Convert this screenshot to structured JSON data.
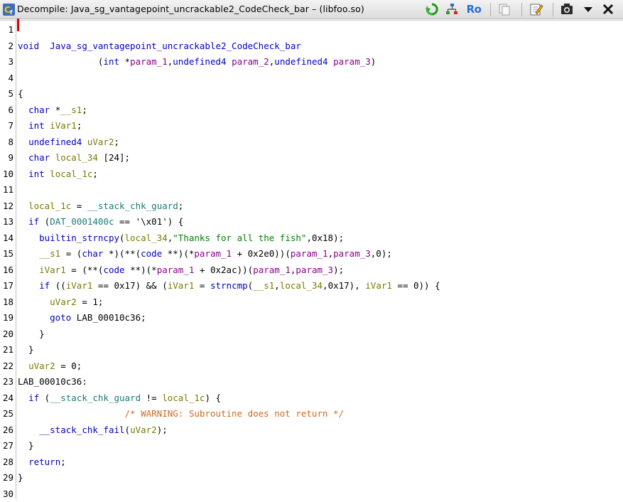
{
  "window": {
    "title": "Decompile: Java_sg_vantagepoint_uncrackable2_CodeCheck_bar – (libfoo.so)"
  },
  "toolbar": {
    "buttons": [
      {
        "name": "refresh-icon"
      },
      {
        "name": "graph-icon"
      },
      {
        "name": "readonly-icon",
        "label": "Ro"
      },
      {
        "name": "copy-icon"
      },
      {
        "name": "edit-icon"
      },
      {
        "name": "snapshot-icon"
      },
      {
        "name": "menu-dropdown-icon"
      },
      {
        "name": "close-icon"
      }
    ]
  },
  "code": {
    "line_numbers": [
      "1",
      "2",
      "3",
      "4",
      "5",
      "6",
      "7",
      "8",
      "9",
      "10",
      "11",
      "12",
      "13",
      "14",
      "15",
      "16",
      "17",
      "18",
      "19",
      "20",
      "21",
      "22",
      "23",
      "24",
      "25",
      "26",
      "27",
      "28",
      "29",
      "30"
    ],
    "lines": [
      [],
      [
        [
          "kw",
          "void"
        ],
        [
          "",
          "  "
        ],
        [
          "fn",
          "Java_sg_vantagepoint_uncrackable2_CodeCheck_bar"
        ]
      ],
      [
        [
          "",
          "               ("
        ],
        [
          "ty",
          "int"
        ],
        [
          "",
          " *"
        ],
        [
          "prm",
          "param_1"
        ],
        [
          "",
          ","
        ],
        [
          "ty",
          "undefined4"
        ],
        [
          "",
          " "
        ],
        [
          "prm",
          "param_2"
        ],
        [
          "",
          ","
        ],
        [
          "ty",
          "undefined4"
        ],
        [
          "",
          " "
        ],
        [
          "prm",
          "param_3"
        ],
        [
          "",
          ")"
        ]
      ],
      [],
      [
        [
          "",
          "{"
        ]
      ],
      [
        [
          "",
          "  "
        ],
        [
          "ty",
          "char"
        ],
        [
          "",
          " *"
        ],
        [
          "var",
          "__s1"
        ],
        [
          "",
          ";"
        ]
      ],
      [
        [
          "",
          "  "
        ],
        [
          "ty",
          "int"
        ],
        [
          "",
          " "
        ],
        [
          "var",
          "iVar1"
        ],
        [
          "",
          ";"
        ]
      ],
      [
        [
          "",
          "  "
        ],
        [
          "ty",
          "undefined4"
        ],
        [
          "",
          " "
        ],
        [
          "var",
          "uVar2"
        ],
        [
          "",
          ";"
        ]
      ],
      [
        [
          "",
          "  "
        ],
        [
          "ty",
          "char"
        ],
        [
          "",
          " "
        ],
        [
          "var",
          "local_34"
        ],
        [
          "",
          " [24];"
        ]
      ],
      [
        [
          "",
          "  "
        ],
        [
          "ty",
          "int"
        ],
        [
          "",
          " "
        ],
        [
          "var",
          "local_1c"
        ],
        [
          "",
          ";"
        ]
      ],
      [],
      [
        [
          "",
          "  "
        ],
        [
          "var",
          "local_1c"
        ],
        [
          "",
          " = "
        ],
        [
          "gl",
          "__stack_chk_guard"
        ],
        [
          "",
          ";"
        ]
      ],
      [
        [
          "",
          "  "
        ],
        [
          "kw",
          "if"
        ],
        [
          "",
          " ("
        ],
        [
          "gl",
          "DAT_0001400c"
        ],
        [
          "",
          " == '\\x01') {"
        ]
      ],
      [
        [
          "",
          "    "
        ],
        [
          "fn",
          "builtin_strncpy"
        ],
        [
          "",
          "("
        ],
        [
          "var",
          "local_34"
        ],
        [
          "",
          ","
        ],
        [
          "str",
          "\"Thanks for all the fish\""
        ],
        [
          "",
          ",0x18);"
        ]
      ],
      [
        [
          "",
          "    "
        ],
        [
          "var",
          "__s1"
        ],
        [
          "",
          " = ("
        ],
        [
          "ty",
          "char"
        ],
        [
          "",
          " *)(**("
        ],
        [
          "ty",
          "code"
        ],
        [
          "",
          " **)(*"
        ],
        [
          "prm",
          "param_1"
        ],
        [
          "",
          " + 0x2e0))("
        ],
        [
          "prm",
          "param_1"
        ],
        [
          "",
          ","
        ],
        [
          "prm",
          "param_3"
        ],
        [
          "",
          ",0);"
        ]
      ],
      [
        [
          "",
          "    "
        ],
        [
          "var",
          "iVar1"
        ],
        [
          "",
          " = (**("
        ],
        [
          "ty",
          "code"
        ],
        [
          "",
          " **)(*"
        ],
        [
          "prm",
          "param_1"
        ],
        [
          "",
          " + 0x2ac))("
        ],
        [
          "prm",
          "param_1"
        ],
        [
          "",
          ","
        ],
        [
          "prm",
          "param_3"
        ],
        [
          "",
          ");"
        ]
      ],
      [
        [
          "",
          "    "
        ],
        [
          "kw",
          "if"
        ],
        [
          "",
          " (("
        ],
        [
          "var",
          "iVar1"
        ],
        [
          "",
          " == 0x17) && ("
        ],
        [
          "var",
          "iVar1"
        ],
        [
          "",
          " = "
        ],
        [
          "fn",
          "strncmp"
        ],
        [
          "",
          "("
        ],
        [
          "var",
          "__s1"
        ],
        [
          "",
          ","
        ],
        [
          "var",
          "local_34"
        ],
        [
          "",
          ",0x17), "
        ],
        [
          "var",
          "iVar1"
        ],
        [
          "",
          " == 0)) {"
        ]
      ],
      [
        [
          "",
          "      "
        ],
        [
          "var",
          "uVar2"
        ],
        [
          "",
          " = 1;"
        ]
      ],
      [
        [
          "",
          "      "
        ],
        [
          "kw",
          "goto"
        ],
        [
          "",
          " "
        ],
        [
          "lbl",
          "LAB_00010c36"
        ],
        [
          "",
          ";"
        ]
      ],
      [
        [
          "",
          "    }"
        ]
      ],
      [
        [
          "",
          "  }"
        ]
      ],
      [
        [
          "",
          "  "
        ],
        [
          "var",
          "uVar2"
        ],
        [
          "",
          " = 0;"
        ]
      ],
      [
        [
          "lbl",
          "LAB_00010c36"
        ],
        [
          "",
          ":"
        ]
      ],
      [
        [
          "",
          "  "
        ],
        [
          "kw",
          "if"
        ],
        [
          "",
          " ("
        ],
        [
          "gl",
          "__stack_chk_guard"
        ],
        [
          "",
          " != "
        ],
        [
          "var",
          "local_1c"
        ],
        [
          "",
          ") {"
        ]
      ],
      [
        [
          "",
          "                    "
        ],
        [
          "cm",
          "/* WARNING: Subroutine does not return */"
        ]
      ],
      [
        [
          "",
          "    "
        ],
        [
          "fn",
          "__stack_chk_fail"
        ],
        [
          "",
          "("
        ],
        [
          "var",
          "uVar2"
        ],
        [
          "",
          ");"
        ]
      ],
      [
        [
          "",
          "  }"
        ]
      ],
      [
        [
          "",
          "  "
        ],
        [
          "kw",
          "return"
        ],
        [
          "",
          ";"
        ]
      ],
      [
        [
          "",
          "}"
        ]
      ],
      []
    ]
  }
}
